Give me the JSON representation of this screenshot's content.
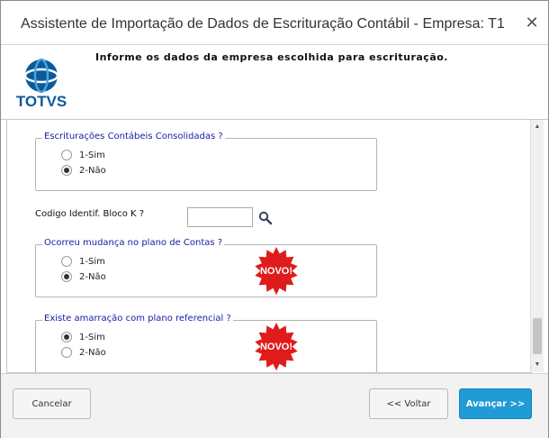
{
  "window": {
    "title": "Assistente de Importação de Dados de Escrituração Contábil - Empresa: T1",
    "close_glyph": "✕"
  },
  "header": {
    "logo_text": "TOTVS",
    "subtitle": "Informe os dados da empresa escolhida para escrituração."
  },
  "form": {
    "consolidadas": {
      "legend": "Escriturações Contábeis Consolidadas ?",
      "options": [
        {
          "label": "1-Sim",
          "selected": false
        },
        {
          "label": "2-Não",
          "selected": true
        }
      ]
    },
    "bloco_k": {
      "label": "Codigo Identif. Bloco K ?",
      "value": ""
    },
    "mudanca_plano": {
      "legend": "Ocorreu mudança no plano de Contas ?",
      "badge": "NOVO!",
      "options": [
        {
          "label": "1-Sim",
          "selected": false
        },
        {
          "label": "2-Não",
          "selected": true
        }
      ]
    },
    "amarracao": {
      "legend": "Existe amarração com plano referencial ?",
      "badge": "NOVO!",
      "options": [
        {
          "label": "1-Sim",
          "selected": true
        },
        {
          "label": "2-Não",
          "selected": false
        }
      ]
    }
  },
  "footer": {
    "cancel_label": "Cancelar",
    "back_label": "<< Voltar",
    "next_label": "Avançar >>"
  },
  "colors": {
    "primary_button": "#1f9bd6",
    "legend_text": "#1a1aa8",
    "badge_red": "#e01b1b",
    "logo_blue": "#0b5a9a"
  }
}
